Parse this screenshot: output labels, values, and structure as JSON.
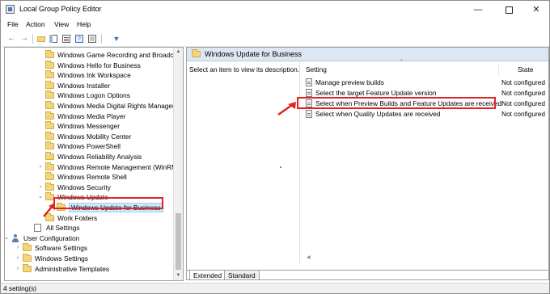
{
  "window": {
    "title": "Local Group Policy Editor",
    "controls": {
      "minimize": "—",
      "maximize": "",
      "close": "✕"
    }
  },
  "menu": [
    "File",
    "Action",
    "View",
    "Help"
  ],
  "toolbar": {
    "buttons": [
      "back-icon",
      "forward-icon",
      "folder-up-icon",
      "show-hide-tree-icon",
      "export-list-icon",
      "help-icon",
      "properties-icon",
      "filter-icon"
    ],
    "back_glyph": "←",
    "forward_glyph": "→",
    "filter_glyph": "▼"
  },
  "tree": {
    "items": [
      {
        "label": "Windows Game Recording and Broadcasting",
        "type": "folder",
        "expandable": false
      },
      {
        "label": "Windows Hello for Business",
        "type": "folder",
        "expandable": false
      },
      {
        "label": "Windows Ink Workspace",
        "type": "folder",
        "expandable": false
      },
      {
        "label": "Windows Installer",
        "type": "folder",
        "expandable": false
      },
      {
        "label": "Windows Logon Options",
        "type": "folder",
        "expandable": false
      },
      {
        "label": "Windows Media Digital Rights Management",
        "type": "folder",
        "expandable": false
      },
      {
        "label": "Windows Media Player",
        "type": "folder",
        "expandable": false
      },
      {
        "label": "Windows Messenger",
        "type": "folder",
        "expandable": false
      },
      {
        "label": "Windows Mobility Center",
        "type": "folder",
        "expandable": false
      },
      {
        "label": "Windows PowerShell",
        "type": "folder",
        "expandable": false
      },
      {
        "label": "Windows Reliability Analysis",
        "type": "folder",
        "expandable": false
      },
      {
        "label": "Windows Remote Management (WinRM)",
        "type": "folder",
        "expandable": true,
        "expander": "›"
      },
      {
        "label": "Windows Remote Shell",
        "type": "folder",
        "expandable": false
      },
      {
        "label": "Windows Security",
        "type": "folder",
        "expandable": true,
        "expander": "›"
      },
      {
        "label": "Windows Update",
        "type": "folder",
        "expandable": true,
        "expander": "⌄"
      },
      {
        "label": "Windows Update for Business",
        "type": "folder",
        "selected": true
      },
      {
        "label": "Work Folders",
        "type": "folder",
        "expandable": false
      },
      {
        "label": "All Settings",
        "type": "doc",
        "expandable": false
      },
      {
        "label": "User Configuration",
        "type": "user",
        "expandable": true,
        "expander": "⌄"
      },
      {
        "label": "Software Settings",
        "type": "folder",
        "expandable": true,
        "expander": "›"
      },
      {
        "label": "Windows Settings",
        "type": "folder",
        "expandable": true,
        "expander": "›"
      },
      {
        "label": "Administrative Templates",
        "type": "folder",
        "expandable": true,
        "expander": "›"
      }
    ]
  },
  "right": {
    "header_title": "Windows Update for Business",
    "description": "Select an item to view its description.",
    "columns": {
      "setting": "Setting",
      "state": "State"
    },
    "settings": [
      {
        "label": "Manage preview builds",
        "state": "Not configured"
      },
      {
        "label": "Select the target Feature Update version",
        "state": "Not configured"
      },
      {
        "label": "Select when Preview Builds and Feature Updates are received",
        "state": "Not configured",
        "highlighted": true
      },
      {
        "label": "Select when Quality Updates are received",
        "state": "Not configured"
      }
    ],
    "tabs": [
      "Extended",
      "Standard"
    ]
  },
  "status": {
    "text": "4 setting(s)"
  },
  "colors": {
    "annotation": "#e02424",
    "selection": "#cce8ff",
    "header_bg": "#dde6f3"
  }
}
